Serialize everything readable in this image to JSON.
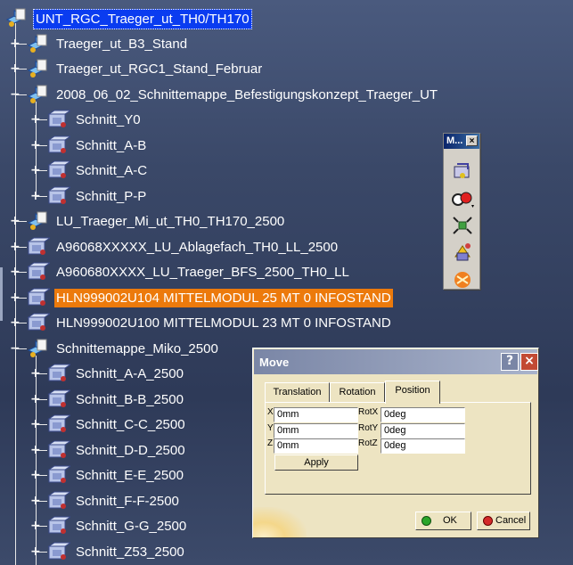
{
  "tree": {
    "items": [
      {
        "label": "UNT_RGC_Traeger_ut_TH0/TH170",
        "toggle": "",
        "state": "root"
      },
      {
        "label": "Traeger_ut_B3_Stand",
        "toggle": "+",
        "state": ""
      },
      {
        "label": "Traeger_ut_RGC1_Stand_Februar",
        "toggle": "+",
        "state": ""
      },
      {
        "label": "2008_06_02_Schnittemappe_Befestigungskonzept_Traeger_UT",
        "toggle": "−",
        "state": ""
      },
      {
        "label": "Schnitt_Y0",
        "toggle": "+",
        "state": ""
      },
      {
        "label": "Schnitt_A-B",
        "toggle": "+",
        "state": ""
      },
      {
        "label": "Schnitt_A-C",
        "toggle": "+",
        "state": ""
      },
      {
        "label": "Schnitt_P-P",
        "toggle": "+",
        "state": ""
      },
      {
        "label": "LU_Traeger_Mi_ut_TH0_TH170_2500",
        "toggle": "+",
        "state": ""
      },
      {
        "label": "A96068XXXXX_LU_Ablagefach_TH0_LL_2500",
        "toggle": "+",
        "state": ""
      },
      {
        "label": "A960680XXXX_LU_Traeger_BFS_2500_TH0_LL",
        "toggle": "+",
        "state": ""
      },
      {
        "label": "HLN999002U104 MITTELMODUL 25 MT 0 INFOSTAND",
        "toggle": "+",
        "state": "selected"
      },
      {
        "label": "HLN999002U100 MITTELMODUL 23 MT 0 INFOSTAND",
        "toggle": "+",
        "state": ""
      },
      {
        "label": "Schnittemappe_Miko_2500",
        "toggle": "−",
        "state": ""
      },
      {
        "label": "Schnitt_A-A_2500",
        "toggle": "+",
        "state": ""
      },
      {
        "label": "Schnitt_B-B_2500",
        "toggle": "+",
        "state": ""
      },
      {
        "label": "Schnitt_C-C_2500",
        "toggle": "+",
        "state": ""
      },
      {
        "label": "Schnitt_D-D_2500",
        "toggle": "+",
        "state": ""
      },
      {
        "label": "Schnitt_E-E_2500",
        "toggle": "+",
        "state": ""
      },
      {
        "label": "Schnitt_F-F-2500",
        "toggle": "+",
        "state": ""
      },
      {
        "label": "Schnitt_G-G_2500",
        "toggle": "+",
        "state": ""
      },
      {
        "label": "Schnitt_Z53_2500",
        "toggle": "+",
        "state": ""
      }
    ]
  },
  "toolbar": {
    "title": "M...",
    "close_glyph": "×",
    "buttons": [
      "manipulate-icon",
      "snap-icon",
      "explode-icon",
      "stop-manipulate-icon",
      "smart-move-icon"
    ]
  },
  "dialog": {
    "title": "Move",
    "help_glyph": "?",
    "close_glyph": "×",
    "tabs": [
      "Translation",
      "Rotation",
      "Position"
    ],
    "active_tab": "Position",
    "position": {
      "x_label": "X",
      "x_value": "0mm",
      "y_label": "Y",
      "y_value": "0mm",
      "z_label": "Z",
      "z_value": "0mm",
      "rx_label": "RotX",
      "rx_value": "0deg",
      "ry_label": "RotY",
      "ry_value": "0deg",
      "rz_label": "RotZ",
      "rz_value": "0deg"
    },
    "apply_label": "Apply",
    "ok_label": "OK",
    "cancel_label": "Cancel"
  },
  "colors": {
    "background": "#3a4868",
    "selection": "#ec7a0c",
    "root_selection": "#0a3cf0",
    "dialog_bg": "#ede4c2",
    "ok_dot": "#2aa52a",
    "cancel_dot": "#d42a2a"
  }
}
